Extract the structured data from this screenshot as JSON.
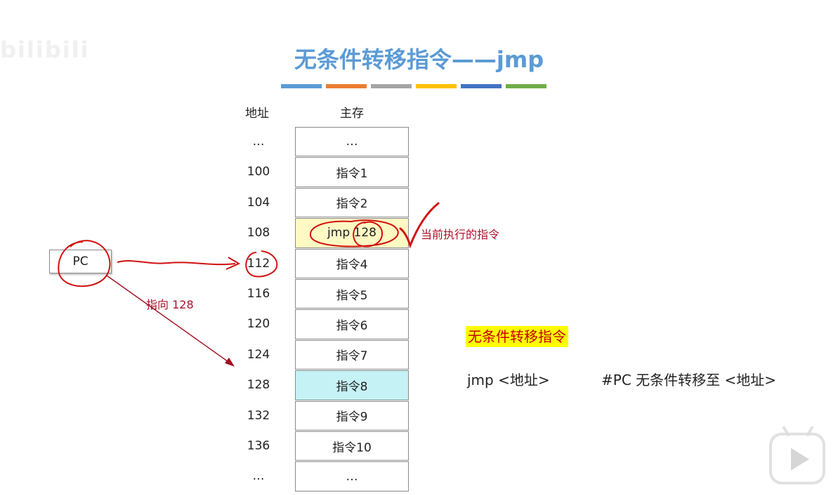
{
  "watermark": "bilibili",
  "title": "无条件转移指令——jmp",
  "color_bars": [
    "#5b9bd5",
    "#ed7d31",
    "#a5a5a5",
    "#ffc000",
    "#4472c4",
    "#70ad47"
  ],
  "headers": {
    "address": "地址",
    "memory": "主存"
  },
  "memory": [
    {
      "address": "…",
      "content": "…",
      "fill": "#ffffff"
    },
    {
      "address": "100",
      "content": "指令1",
      "fill": "#ffffff"
    },
    {
      "address": "104",
      "content": "指令2",
      "fill": "#ffffff"
    },
    {
      "address": "108",
      "content": "jmp 128",
      "fill": "#fff9c4"
    },
    {
      "address": "112",
      "content": "指令4",
      "fill": "#ffffff"
    },
    {
      "address": "116",
      "content": "指令5",
      "fill": "#ffffff"
    },
    {
      "address": "120",
      "content": "指令6",
      "fill": "#ffffff"
    },
    {
      "address": "124",
      "content": "指令7",
      "fill": "#ffffff"
    },
    {
      "address": "128",
      "content": "指令8",
      "fill": "#c5f2f4"
    },
    {
      "address": "132",
      "content": "指令9",
      "fill": "#ffffff"
    },
    {
      "address": "136",
      "content": "指令10",
      "fill": "#ffffff"
    },
    {
      "address": "…",
      "content": "…",
      "fill": "#ffffff"
    }
  ],
  "pc_label": "PC",
  "annotations": {
    "current_instruction": "当前执行的指令",
    "points_to": "指向 128"
  },
  "explanation": {
    "heading": "无条件转移指令",
    "syntax": "jmp <地址>",
    "comment": "#PC 无条件转移至 <地址>"
  },
  "colors": {
    "title": "#5b9bd5",
    "annotation_red": "#c00000",
    "highlight_yellow": "#ffff00"
  }
}
